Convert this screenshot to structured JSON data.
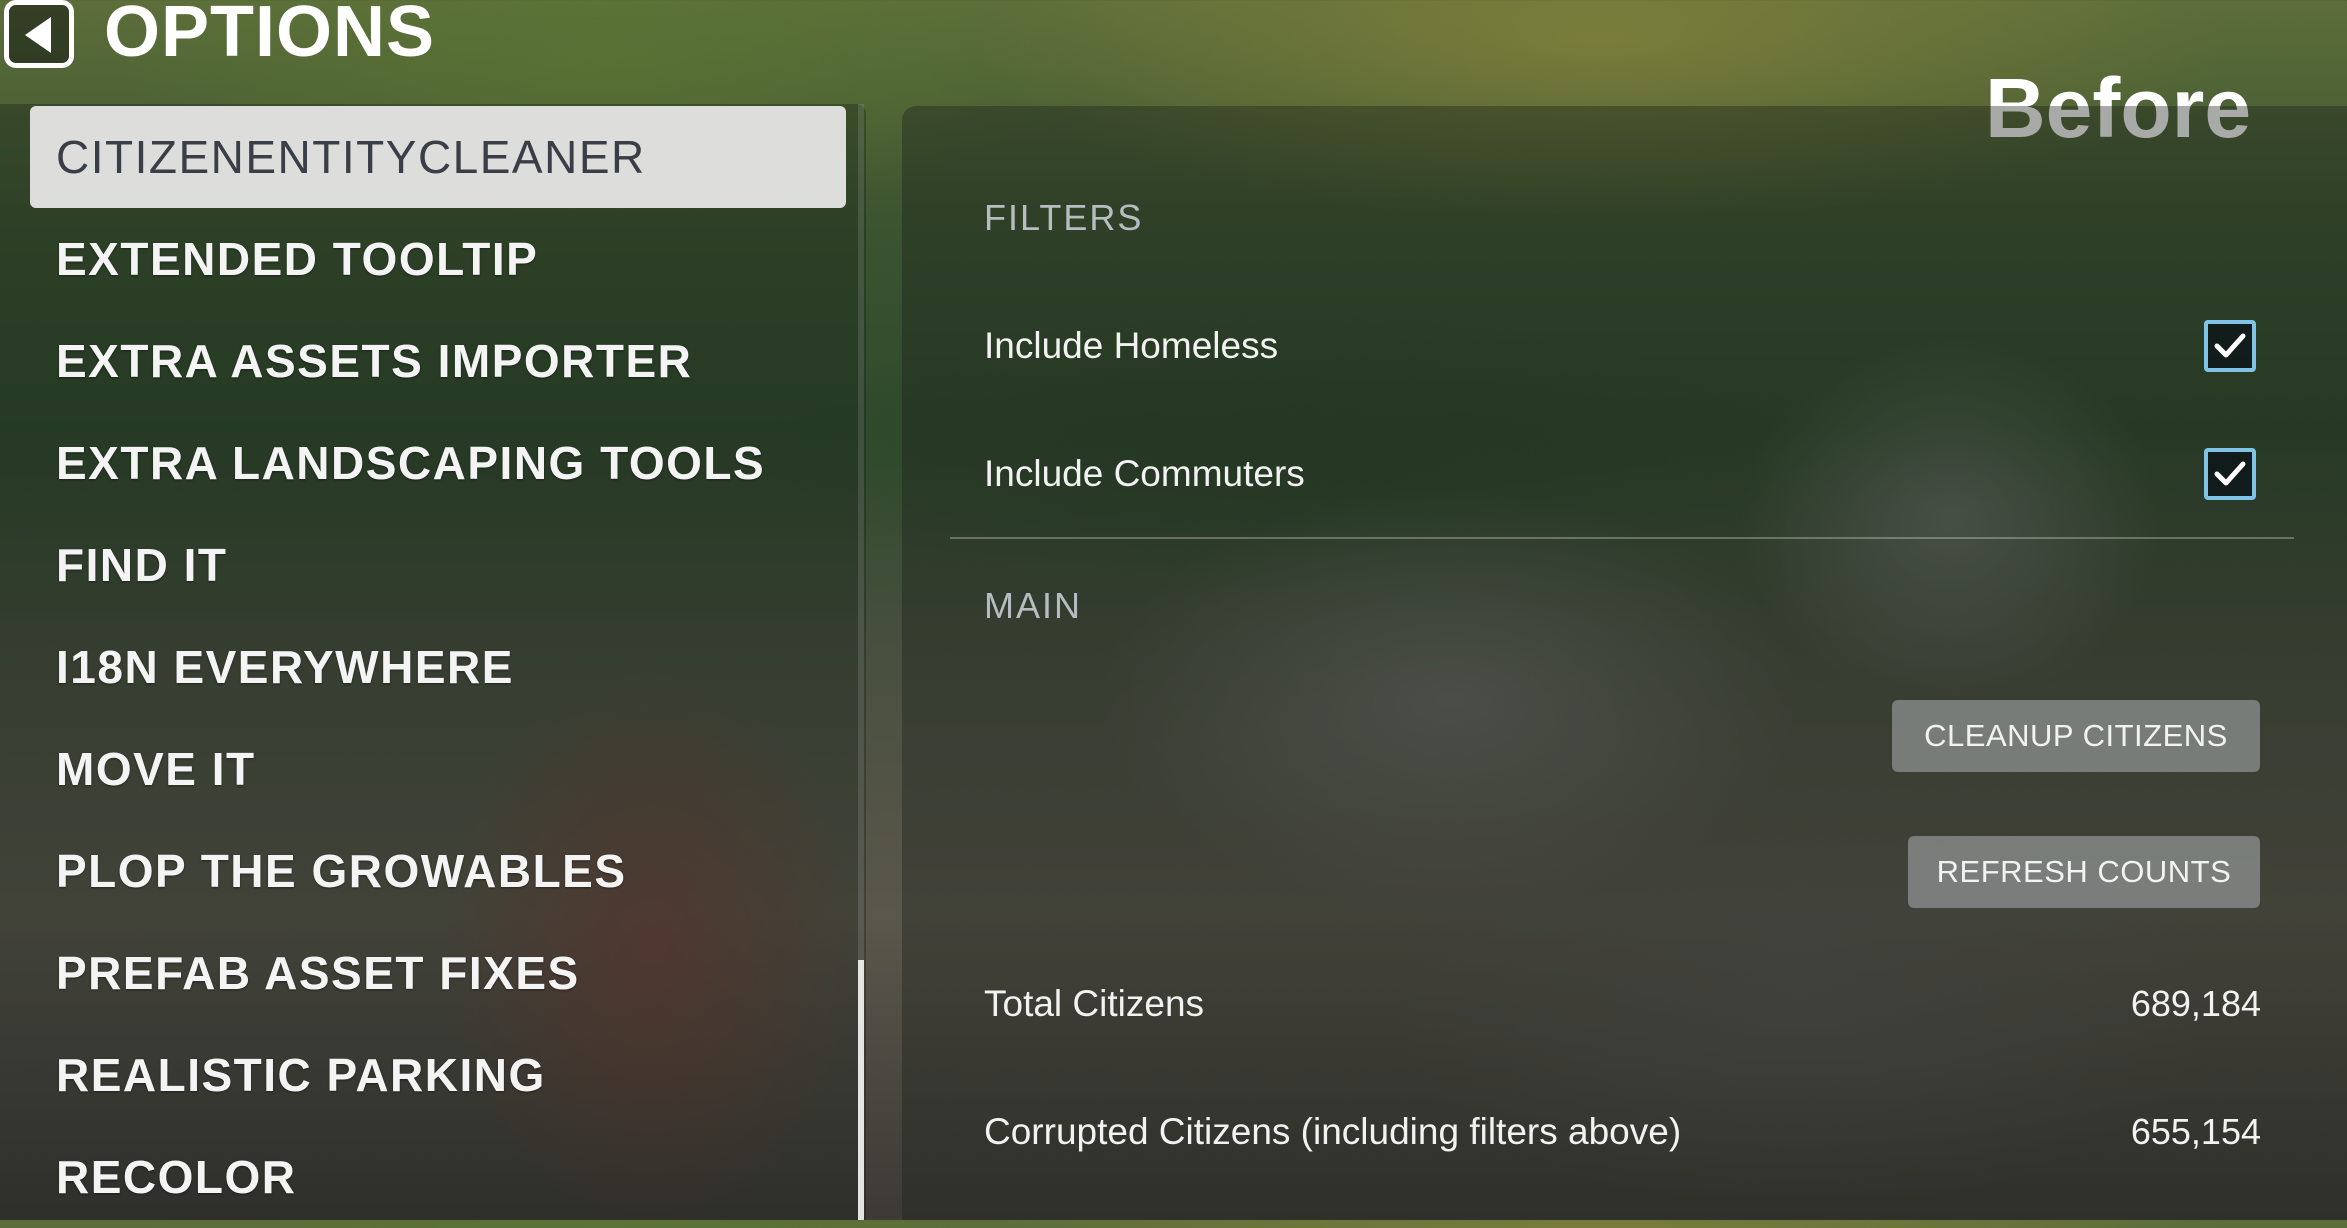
{
  "header": {
    "title": "OPTIONS",
    "back_icon": "back-arrow-icon",
    "overlay_label": "Before"
  },
  "sidebar": {
    "items": [
      {
        "label": "CITIZENENTITYCLEANER",
        "selected": true
      },
      {
        "label": "EXTENDED TOOLTIP",
        "selected": false
      },
      {
        "label": "EXTRA ASSETS IMPORTER",
        "selected": false
      },
      {
        "label": "EXTRA LANDSCAPING TOOLS",
        "selected": false
      },
      {
        "label": "FIND IT",
        "selected": false
      },
      {
        "label": "I18N EVERYWHERE",
        "selected": false
      },
      {
        "label": "MOVE IT",
        "selected": false
      },
      {
        "label": "PLOP THE GROWABLES",
        "selected": false
      },
      {
        "label": "PREFAB ASSET FIXES",
        "selected": false
      },
      {
        "label": "REALISTIC PARKING",
        "selected": false
      },
      {
        "label": "RECOLOR",
        "selected": false
      }
    ]
  },
  "panel": {
    "filters": {
      "section_label": "FILTERS",
      "include_homeless": {
        "label": "Include Homeless",
        "checked": true
      },
      "include_commuters": {
        "label": "Include Commuters",
        "checked": true
      }
    },
    "main": {
      "section_label": "MAIN",
      "cleanup_button": "CLEANUP CITIZENS",
      "refresh_button": "REFRESH COUNTS",
      "total_citizens": {
        "label": "Total Citizens",
        "value": "689,184"
      },
      "corrupted_citizens": {
        "label": "Corrupted Citizens (including filters above)",
        "value": "655,154"
      }
    }
  },
  "colors": {
    "checkbox_border": "#7fc4e6",
    "selected_item_bg": "#e8e8e8",
    "section_label": "#b7bcc0"
  }
}
